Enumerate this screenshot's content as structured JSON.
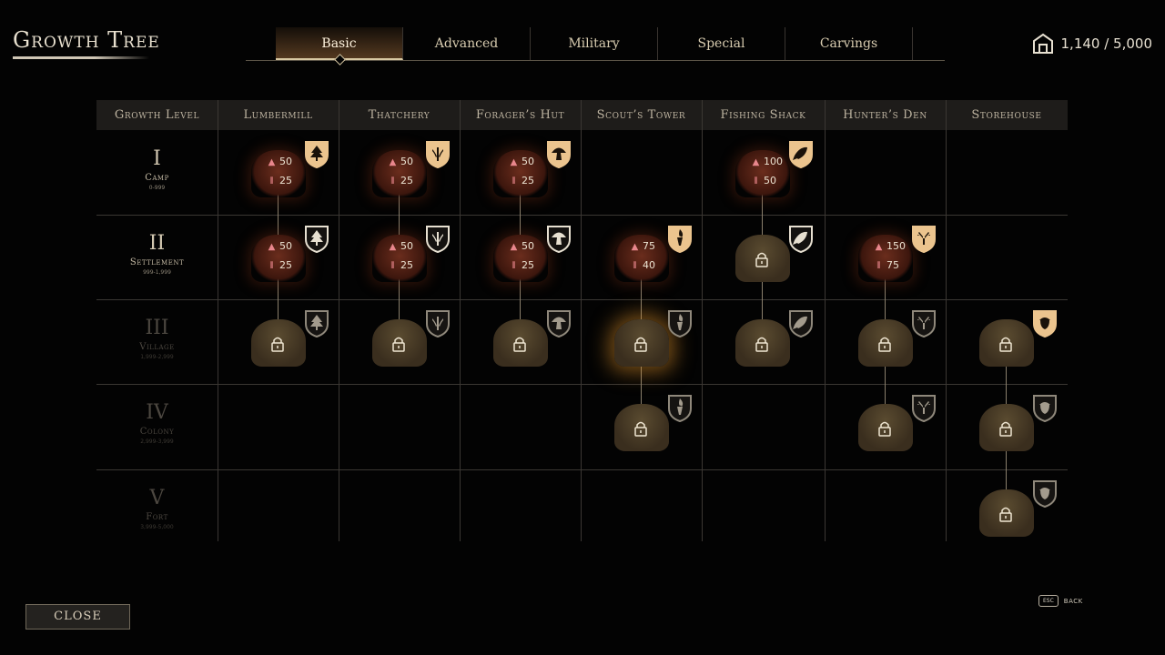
{
  "title": "Growth Tree",
  "tabs": [
    {
      "label": "Basic",
      "active": true
    },
    {
      "label": "Advanced",
      "active": false
    },
    {
      "label": "Military",
      "active": false
    },
    {
      "label": "Special",
      "active": false
    },
    {
      "label": "Carvings",
      "active": false
    }
  ],
  "resource": {
    "icon": "settlement-house-icon",
    "value": "1,140 / 5,000"
  },
  "table": {
    "level_header": "Growth Level",
    "columns": [
      "Lumbermill",
      "Thatchery",
      "Forager’s Hut",
      "Scout’s Tower",
      "Fishing Shack",
      "Hunter’s Den",
      "Storehouse"
    ],
    "levels": [
      {
        "numeral": "I",
        "name": "Camp",
        "range": "0-999",
        "reached": true
      },
      {
        "numeral": "II",
        "name": "Settlement",
        "range": "999-1,999",
        "reached": true
      },
      {
        "numeral": "III",
        "name": "Village",
        "range": "1,999-2,999",
        "reached": false
      },
      {
        "numeral": "IV",
        "name": "Colony",
        "range": "2,999-3,999",
        "reached": false
      },
      {
        "numeral": "V",
        "name": "Fort",
        "range": "3,999-5,000",
        "reached": false
      }
    ],
    "nodes": [
      {
        "col": 0,
        "row": 0,
        "state": "available",
        "cost": {
          "wood": "50",
          "thatch": "25"
        },
        "icon": "tree-icon",
        "shield": "filled"
      },
      {
        "col": 1,
        "row": 0,
        "state": "available",
        "cost": {
          "wood": "50",
          "thatch": "25"
        },
        "icon": "wheat-icon",
        "shield": "filled"
      },
      {
        "col": 2,
        "row": 0,
        "state": "available",
        "cost": {
          "wood": "50",
          "thatch": "25"
        },
        "icon": "mushroom-icon",
        "shield": "filled"
      },
      {
        "col": 4,
        "row": 0,
        "state": "available",
        "cost": {
          "wood": "100",
          "thatch": "50"
        },
        "icon": "fish-icon",
        "shield": "filled"
      },
      {
        "col": 0,
        "row": 1,
        "state": "available",
        "cost": {
          "wood": "50",
          "thatch": "25"
        },
        "icon": "tree-icon",
        "shield": "outline"
      },
      {
        "col": 1,
        "row": 1,
        "state": "available",
        "cost": {
          "wood": "50",
          "thatch": "25"
        },
        "icon": "wheat-icon",
        "shield": "outline"
      },
      {
        "col": 2,
        "row": 1,
        "state": "available",
        "cost": {
          "wood": "50",
          "thatch": "25"
        },
        "icon": "mushroom-icon",
        "shield": "outline"
      },
      {
        "col": 3,
        "row": 1,
        "state": "available",
        "cost": {
          "wood": "75",
          "thatch": "40"
        },
        "icon": "torch-icon",
        "shield": "filled"
      },
      {
        "col": 4,
        "row": 1,
        "state": "locked",
        "icon": "fish-icon",
        "shield": "outline"
      },
      {
        "col": 5,
        "row": 1,
        "state": "available",
        "cost": {
          "wood": "150",
          "thatch": "75"
        },
        "icon": "antler-icon",
        "shield": "filled"
      },
      {
        "col": 0,
        "row": 2,
        "state": "locked",
        "icon": "tree-icon",
        "shield": "dark"
      },
      {
        "col": 1,
        "row": 2,
        "state": "locked",
        "icon": "wheat-icon",
        "shield": "dark"
      },
      {
        "col": 2,
        "row": 2,
        "state": "locked",
        "icon": "mushroom-icon",
        "shield": "dark"
      },
      {
        "col": 3,
        "row": 2,
        "state": "locked",
        "icon": "torch-icon",
        "shield": "dark",
        "glow": true
      },
      {
        "col": 4,
        "row": 2,
        "state": "locked",
        "icon": "fish-icon",
        "shield": "dark"
      },
      {
        "col": 5,
        "row": 2,
        "state": "locked",
        "icon": "antler-icon",
        "shield": "dark"
      },
      {
        "col": 6,
        "row": 2,
        "state": "locked",
        "icon": "acorn-icon",
        "shield": "filled"
      },
      {
        "col": 3,
        "row": 3,
        "state": "locked",
        "icon": "torch-icon",
        "shield": "dark"
      },
      {
        "col": 5,
        "row": 3,
        "state": "locked",
        "icon": "antler-icon",
        "shield": "dark"
      },
      {
        "col": 6,
        "row": 3,
        "state": "locked",
        "icon": "acorn-icon",
        "shield": "dark"
      },
      {
        "col": 6,
        "row": 4,
        "state": "locked",
        "icon": "acorn-icon",
        "shield": "dark"
      }
    ],
    "connectors": [
      {
        "col": 0,
        "from": 0,
        "to": 2
      },
      {
        "col": 1,
        "from": 0,
        "to": 2
      },
      {
        "col": 2,
        "from": 0,
        "to": 2
      },
      {
        "col": 3,
        "from": 1,
        "to": 3
      },
      {
        "col": 4,
        "from": 0,
        "to": 2
      },
      {
        "col": 5,
        "from": 1,
        "to": 3
      },
      {
        "col": 6,
        "from": 2,
        "to": 4
      }
    ]
  },
  "colors": {
    "accent": "#e9c48d",
    "cost": "#e8868c",
    "active_tab": "#8d5e34"
  },
  "footer": {
    "close_label": "CLOSE",
    "esc_key": "ESC",
    "back_label": "BACK"
  }
}
